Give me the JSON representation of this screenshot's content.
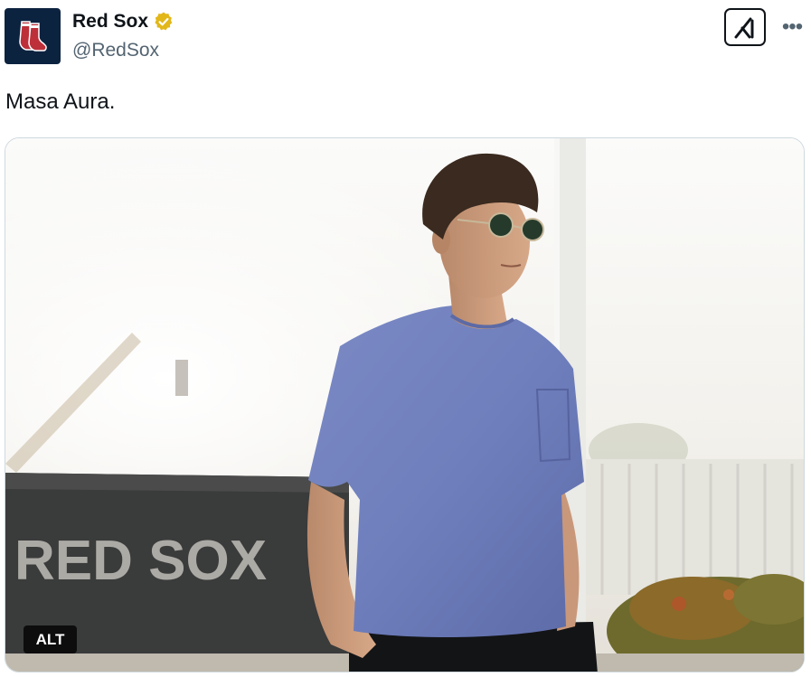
{
  "account": {
    "display_name": "Red Sox",
    "handle": "@RedSox",
    "verified_badge_icon": "verified-gold-icon"
  },
  "actions": {
    "grok_icon": "grok-icon",
    "more_icon": "more-icon",
    "more_label": "•••"
  },
  "tweet": {
    "text": "Masa Aura."
  },
  "media": {
    "alt_label": "ALT",
    "banner_text": "RED SOX"
  },
  "colors": {
    "brand_navy": "#0c2340",
    "brand_red": "#bd3039",
    "verified_gold": "#e2b719",
    "handle_gray": "#536471"
  }
}
